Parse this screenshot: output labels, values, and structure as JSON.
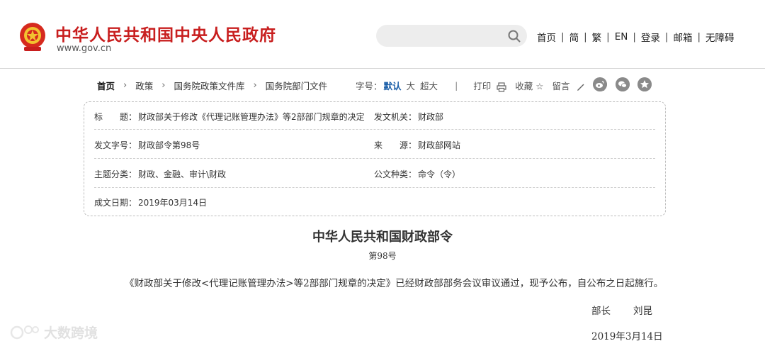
{
  "header": {
    "title": "中华人民共和国中央人民政府",
    "domain": "www.gov.cn",
    "brand_color": "#c81e1e",
    "search": {
      "placeholder": "",
      "icon": "search-icon"
    },
    "nav": [
      {
        "label": "首页"
      },
      {
        "label": "简"
      },
      {
        "label": "繁"
      },
      {
        "label": "EN"
      },
      {
        "label": "登录"
      },
      {
        "label": "邮箱"
      },
      {
        "label": "无障碍"
      }
    ]
  },
  "breadcrumb": [
    "首页",
    "政策",
    "国务院政策文件库",
    "国务院部门文件"
  ],
  "toolbar": {
    "font_label": "字号：",
    "font_default": "默认",
    "font_large": "大",
    "font_xlarge": "超大",
    "separator": "|",
    "print": "打印",
    "favorite": "收藏",
    "comment": "留言",
    "accent_color": "#1c5fa8",
    "share_icons": [
      "weibo-icon",
      "wechat-icon",
      "qzone-icon"
    ]
  },
  "meta": {
    "title_label": "标　　题：",
    "title": "财政部关于修改《代理记账管理办法》等2部部门规章的决定",
    "issuer_label": "发文机关：",
    "issuer": "财政部",
    "doc_no_label": "发文字号：",
    "doc_no": "财政部令第98号",
    "source_label": "来　　源：",
    "source": "财政部网站",
    "topic_label": "主题分类：",
    "topic": "财政、金融、审计\\财政",
    "type_label": "公文种类：",
    "type": "命令（令）",
    "date_label": "成文日期：",
    "date": "2019年03月14日"
  },
  "article": {
    "title": "中华人民共和国财政部令",
    "number": "第98号",
    "body": "《财政部关于修改<代理记账管理办法>等2部部门规章的决定》已经财政部部务会议审议通过，现予公布，自公布之日起施行。",
    "signer_role": "部长",
    "signer_name": "刘昆",
    "sign_date": "2019年3月14日"
  },
  "watermark": {
    "text": "大数跨境"
  }
}
